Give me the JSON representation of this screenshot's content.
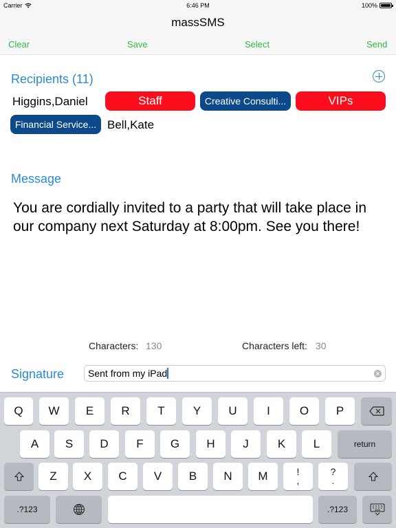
{
  "status": {
    "carrier": "Carrier",
    "time": "6:46 PM",
    "battery": "100%",
    "battery_level": 1.0
  },
  "nav": {
    "title": "massSMS",
    "clear": "Clear",
    "save": "Save",
    "select": "Select",
    "send": "Send"
  },
  "recipients": {
    "label": "Recipients (11)",
    "row1": [
      "Higgins,Daniel",
      "Staff",
      "Creative Consulti...",
      "VIPs"
    ],
    "row2": [
      "Financial Service...",
      "Bell,Kate"
    ]
  },
  "message": {
    "label": "Message",
    "text": "You are cordially invited to a party that will take place in our company next Saturday at 8:00pm. See you there!"
  },
  "counts": {
    "characters_label": "Characters:",
    "characters_value": "130",
    "left_label": "Characters left:",
    "left_value": "30"
  },
  "signature": {
    "label": "Signature",
    "value": "Sent from my iPad"
  },
  "keyboard": {
    "row1": [
      "Q",
      "W",
      "E",
      "R",
      "T",
      "Y",
      "U",
      "I",
      "O",
      "P"
    ],
    "row2": [
      "A",
      "S",
      "D",
      "F",
      "G",
      "H",
      "J",
      "K",
      "L"
    ],
    "return": "return",
    "row3": [
      "Z",
      "X",
      "C",
      "V",
      "B",
      "N",
      "M"
    ],
    "exclam": [
      "!",
      ","
    ],
    "question": [
      "?",
      "."
    ],
    "num_left": ".?123",
    "num_right": ".?123"
  },
  "colors": {
    "accent": "#2b8ad6",
    "nav_button": "#2dbd3e",
    "chip_red": "#fc0d1b",
    "chip_blue": "#0d4a8c"
  }
}
